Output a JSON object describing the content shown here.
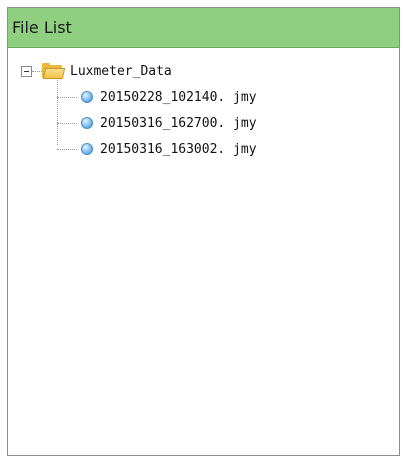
{
  "panel": {
    "title": "File List"
  },
  "tree": {
    "root": {
      "label": "Luxmeter_Data",
      "icon": "folder-icon",
      "expanded": true
    },
    "files": [
      {
        "label": "20150228_102140. jmy",
        "icon": "file-icon"
      },
      {
        "label": "20150316_162700. jmy",
        "icon": "file-icon"
      },
      {
        "label": "20150316_163002. jmy",
        "icon": "file-icon"
      }
    ]
  },
  "colors": {
    "header_bg": "#8ed07f",
    "panel_border": "#8c8c8c",
    "folder": "#e9b93b",
    "file_icon": "#3b8fd4"
  }
}
